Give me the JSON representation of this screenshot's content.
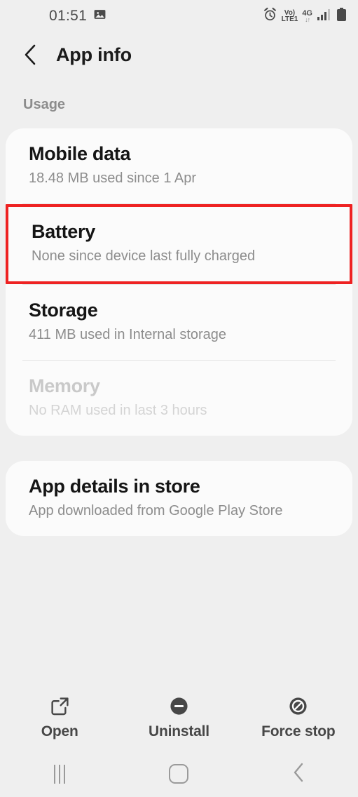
{
  "statusbar": {
    "time": "01:51",
    "image_icon": "image-icon",
    "alarm_icon": "alarm-icon",
    "volte_top": "Vo)",
    "volte_bottom": "LTE1",
    "network_label": "4G",
    "network_arrows": "↓↑",
    "signal_icon": "signal-bars-icon",
    "battery_icon": "battery-icon"
  },
  "header": {
    "back_label": "back-chevron",
    "title": "App info"
  },
  "sections": {
    "usage_label": "Usage"
  },
  "usage_card": {
    "rows": [
      {
        "title": "Mobile data",
        "sub": "18.48 MB used since 1 Apr",
        "disabled": false,
        "highlighted": false
      },
      {
        "title": "Battery",
        "sub": "None since device last fully charged",
        "disabled": false,
        "highlighted": true
      },
      {
        "title": "Storage",
        "sub": "411 MB used in Internal storage",
        "disabled": false,
        "highlighted": false
      },
      {
        "title": "Memory",
        "sub": "No RAM used in last 3 hours",
        "disabled": true,
        "highlighted": false
      }
    ]
  },
  "store_card": {
    "rows": [
      {
        "title": "App details in store",
        "sub": "App downloaded from Google Play Store",
        "disabled": false,
        "highlighted": false
      }
    ]
  },
  "actions": [
    {
      "label": "Open",
      "icon": "open-external-icon"
    },
    {
      "label": "Uninstall",
      "icon": "uninstall-minus-icon"
    },
    {
      "label": "Force stop",
      "icon": "force-stop-icon"
    }
  ],
  "navbar": [
    {
      "name": "recents-button"
    },
    {
      "name": "home-button"
    },
    {
      "name": "back-button"
    }
  ],
  "colors": {
    "highlight": "#ee2222",
    "background": "#efefef",
    "card": "#fbfbfb",
    "title_text": "#151515",
    "sub_text": "#8d8d8d",
    "disabled_text": "#c9c9c9"
  }
}
